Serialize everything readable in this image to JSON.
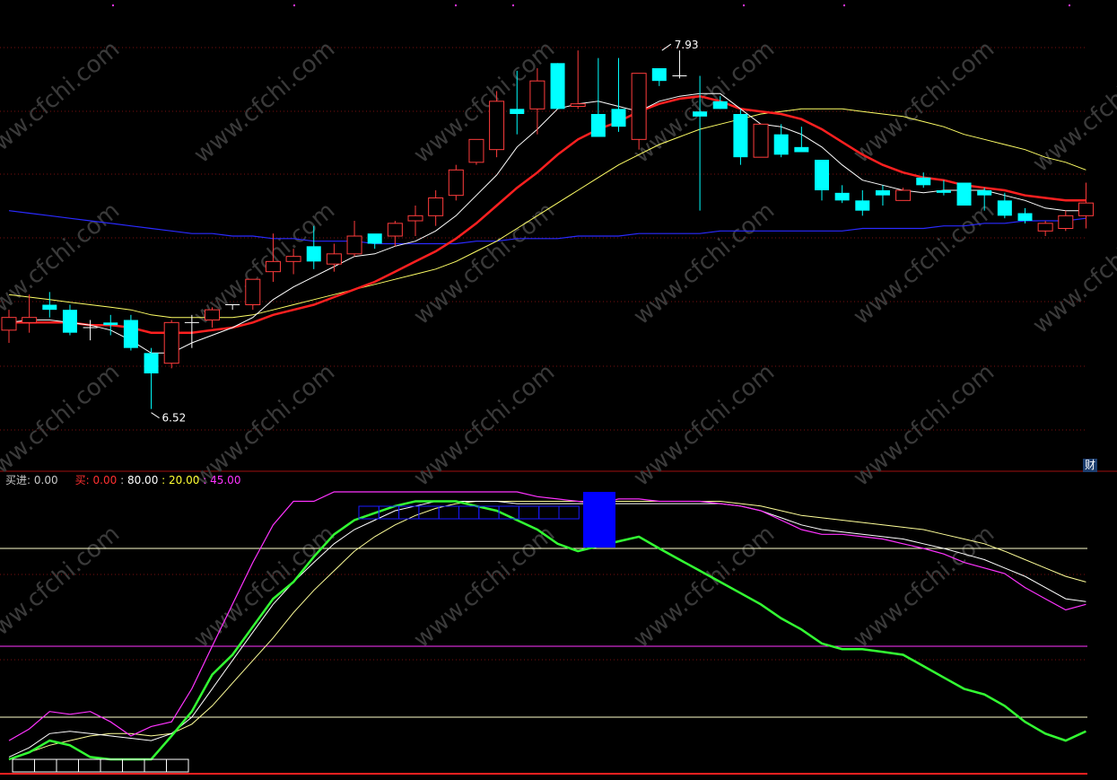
{
  "indicator": {
    "buy_in_label": "买进:",
    "buy_in_value": "0.00",
    "buy_label": "买:",
    "buy_value": "0.00",
    "sep": ":",
    "level_80": "80.00",
    "level_20": "20.00",
    "level_45": "45.00"
  },
  "fin_badge": "财",
  "watermark": "www.cfchi.com",
  "colors": {
    "background": "#000000",
    "up_candle": "#ff3c3c",
    "down_candle": "#00ffff",
    "ma_short": "#ffffff",
    "ma_mid": "#ff2020",
    "ma_long": "#ffff66",
    "ma_very_long": "#2a2aff",
    "osc_magenta": "#ff33ff",
    "osc_green": "#33ff33",
    "osc_white": "#ffffff",
    "osc_yellow": "#ffff99",
    "signal_blue": "#0000ff",
    "level_white": "#ffffcc",
    "level_magenta": "#ff33ff",
    "grid_red": "#7a1010"
  },
  "chart_data": {
    "type": "candlestick",
    "price_annotations": [
      {
        "label": "7.93",
        "kind": "high"
      },
      {
        "label": "6.52",
        "kind": "low"
      }
    ],
    "ylim": [
      6.3,
      8.1
    ],
    "candles": [
      {
        "o": 6.83,
        "h": 6.91,
        "l": 6.78,
        "c": 6.88
      },
      {
        "o": 6.86,
        "h": 6.97,
        "l": 6.82,
        "c": 6.88
      },
      {
        "o": 6.93,
        "h": 6.98,
        "l": 6.88,
        "c": 6.91
      },
      {
        "o": 6.91,
        "h": 6.93,
        "l": 6.81,
        "c": 6.82
      },
      {
        "o": 6.84,
        "h": 6.87,
        "l": 6.79,
        "c": 6.84
      },
      {
        "o": 6.86,
        "h": 6.89,
        "l": 6.81,
        "c": 6.85
      },
      {
        "o": 6.87,
        "h": 6.89,
        "l": 6.75,
        "c": 6.76
      },
      {
        "o": 6.74,
        "h": 6.76,
        "l": 6.52,
        "c": 6.66
      },
      {
        "o": 6.7,
        "h": 6.87,
        "l": 6.68,
        "c": 6.86
      },
      {
        "o": 6.86,
        "h": 6.89,
        "l": 6.76,
        "c": 6.86
      },
      {
        "o": 6.87,
        "h": 6.92,
        "l": 6.84,
        "c": 6.91
      },
      {
        "o": 6.93,
        "h": 6.93,
        "l": 6.91,
        "c": 6.93
      },
      {
        "o": 6.93,
        "h": 7.03,
        "l": 6.91,
        "c": 7.03
      },
      {
        "o": 7.06,
        "h": 7.21,
        "l": 7.02,
        "c": 7.1
      },
      {
        "o": 7.1,
        "h": 7.15,
        "l": 7.05,
        "c": 7.12
      },
      {
        "o": 7.16,
        "h": 7.24,
        "l": 7.07,
        "c": 7.1
      },
      {
        "o": 7.09,
        "h": 7.17,
        "l": 7.06,
        "c": 7.13
      },
      {
        "o": 7.13,
        "h": 7.26,
        "l": 7.12,
        "c": 7.2
      },
      {
        "o": 7.21,
        "h": 7.2,
        "l": 7.15,
        "c": 7.17
      },
      {
        "o": 7.2,
        "h": 7.26,
        "l": 7.16,
        "c": 7.25
      },
      {
        "o": 7.26,
        "h": 7.32,
        "l": 7.2,
        "c": 7.28
      },
      {
        "o": 7.28,
        "h": 7.38,
        "l": 7.24,
        "c": 7.35
      },
      {
        "o": 7.36,
        "h": 7.48,
        "l": 7.34,
        "c": 7.46
      },
      {
        "o": 7.49,
        "h": 7.58,
        "l": 7.48,
        "c": 7.58
      },
      {
        "o": 7.54,
        "h": 7.77,
        "l": 7.51,
        "c": 7.73
      },
      {
        "o": 7.7,
        "h": 7.85,
        "l": 7.6,
        "c": 7.68
      },
      {
        "o": 7.7,
        "h": 7.86,
        "l": 7.6,
        "c": 7.81
      },
      {
        "o": 7.88,
        "h": 7.88,
        "l": 7.71,
        "c": 7.7
      },
      {
        "o": 7.71,
        "h": 7.93,
        "l": 7.7,
        "c": 7.72
      },
      {
        "o": 7.68,
        "h": 7.9,
        "l": 7.59,
        "c": 7.59
      },
      {
        "o": 7.7,
        "h": 7.9,
        "l": 7.61,
        "c": 7.63
      },
      {
        "o": 7.58,
        "h": 7.84,
        "l": 7.54,
        "c": 7.84
      },
      {
        "o": 7.86,
        "h": 7.86,
        "l": 7.79,
        "c": 7.81
      },
      {
        "o": 7.83,
        "h": 7.93,
        "l": 7.82,
        "c": 7.83
      },
      {
        "o": 7.69,
        "h": 7.83,
        "l": 7.3,
        "c": 7.67
      },
      {
        "o": 7.73,
        "h": 7.75,
        "l": 7.7,
        "c": 7.7
      },
      {
        "o": 7.68,
        "h": 7.7,
        "l": 7.48,
        "c": 7.51
      },
      {
        "o": 7.51,
        "h": 7.64,
        "l": 7.51,
        "c": 7.64
      },
      {
        "o": 7.6,
        "h": 7.64,
        "l": 7.51,
        "c": 7.52
      },
      {
        "o": 7.55,
        "h": 7.63,
        "l": 7.53,
        "c": 7.53
      },
      {
        "o": 7.5,
        "h": 7.5,
        "l": 7.34,
        "c": 7.38
      },
      {
        "o": 7.37,
        "h": 7.4,
        "l": 7.33,
        "c": 7.34
      },
      {
        "o": 7.34,
        "h": 7.38,
        "l": 7.28,
        "c": 7.3
      },
      {
        "o": 7.38,
        "h": 7.4,
        "l": 7.32,
        "c": 7.36
      },
      {
        "o": 7.34,
        "h": 7.39,
        "l": 7.34,
        "c": 7.38
      },
      {
        "o": 7.43,
        "h": 7.45,
        "l": 7.39,
        "c": 7.4
      },
      {
        "o": 7.38,
        "h": 7.42,
        "l": 7.36,
        "c": 7.37
      },
      {
        "o": 7.41,
        "h": 7.41,
        "l": 7.33,
        "c": 7.32
      },
      {
        "o": 7.38,
        "h": 7.39,
        "l": 7.3,
        "c": 7.36
      },
      {
        "o": 7.34,
        "h": 7.37,
        "l": 7.27,
        "c": 7.28
      },
      {
        "o": 7.29,
        "h": 7.31,
        "l": 7.25,
        "c": 7.26
      },
      {
        "o": 7.22,
        "h": 7.26,
        "l": 7.2,
        "c": 7.25
      },
      {
        "o": 7.23,
        "h": 7.3,
        "l": 7.22,
        "c": 7.28
      },
      {
        "o": 7.28,
        "h": 7.41,
        "l": 7.23,
        "c": 7.33
      }
    ],
    "ma_short": [
      6.86,
      6.87,
      6.87,
      6.86,
      6.85,
      6.83,
      6.79,
      6.74,
      6.74,
      6.78,
      6.81,
      6.84,
      6.88,
      6.95,
      7.0,
      7.04,
      7.08,
      7.12,
      7.13,
      7.16,
      7.18,
      7.22,
      7.28,
      7.36,
      7.44,
      7.55,
      7.62,
      7.7,
      7.72,
      7.73,
      7.71,
      7.69,
      7.73,
      7.75,
      7.76,
      7.76,
      7.7,
      7.64,
      7.63,
      7.6,
      7.55,
      7.48,
      7.42,
      7.4,
      7.38,
      7.37,
      7.38,
      7.38,
      7.38,
      7.36,
      7.34,
      7.31,
      7.3,
      7.3
    ],
    "ma_mid": [
      6.86,
      6.86,
      6.86,
      6.86,
      6.85,
      6.85,
      6.84,
      6.82,
      6.82,
      6.82,
      6.83,
      6.84,
      6.86,
      6.89,
      6.91,
      6.93,
      6.96,
      6.99,
      7.02,
      7.06,
      7.1,
      7.14,
      7.19,
      7.25,
      7.32,
      7.39,
      7.45,
      7.52,
      7.58,
      7.62,
      7.65,
      7.69,
      7.72,
      7.74,
      7.75,
      7.73,
      7.7,
      7.69,
      7.68,
      7.66,
      7.62,
      7.57,
      7.52,
      7.48,
      7.45,
      7.43,
      7.42,
      7.4,
      7.39,
      7.38,
      7.36,
      7.35,
      7.34,
      7.34
    ],
    "ma_long": [
      6.97,
      6.96,
      6.95,
      6.94,
      6.93,
      6.92,
      6.91,
      6.89,
      6.88,
      6.88,
      6.88,
      6.88,
      6.89,
      6.91,
      6.93,
      6.95,
      6.97,
      6.99,
      7.01,
      7.03,
      7.05,
      7.07,
      7.1,
      7.14,
      7.18,
      7.23,
      7.28,
      7.33,
      7.38,
      7.43,
      7.48,
      7.52,
      7.56,
      7.59,
      7.62,
      7.64,
      7.66,
      7.68,
      7.69,
      7.7,
      7.7,
      7.7,
      7.69,
      7.68,
      7.67,
      7.65,
      7.63,
      7.6,
      7.58,
      7.56,
      7.54,
      7.51,
      7.49,
      7.46
    ],
    "ma_very_long": [
      7.3,
      7.29,
      7.28,
      7.27,
      7.26,
      7.25,
      7.24,
      7.23,
      7.22,
      7.21,
      7.21,
      7.2,
      7.2,
      7.19,
      7.19,
      7.18,
      7.18,
      7.18,
      7.17,
      7.17,
      7.17,
      7.17,
      7.17,
      7.18,
      7.18,
      7.19,
      7.19,
      7.19,
      7.2,
      7.2,
      7.2,
      7.21,
      7.21,
      7.21,
      7.21,
      7.22,
      7.22,
      7.22,
      7.22,
      7.22,
      7.22,
      7.22,
      7.23,
      7.23,
      7.23,
      7.23,
      7.24,
      7.24,
      7.25,
      7.25,
      7.26,
      7.26,
      7.26,
      7.27
    ],
    "oscillator": {
      "ylim": [
        -5,
        110
      ],
      "levels": [
        80,
        20,
        45
      ],
      "magenta": [
        10,
        15,
        22,
        21,
        22,
        18,
        12,
        16,
        18,
        30,
        45,
        60,
        75,
        90,
        100,
        100,
        104,
        104,
        104,
        104,
        104,
        104,
        104,
        104,
        104,
        104,
        102,
        101,
        100,
        99,
        101,
        101,
        100,
        100,
        100,
        99,
        98,
        96,
        92,
        88,
        86,
        86,
        85,
        84,
        82,
        80,
        78,
        75,
        73,
        71,
        66,
        62,
        58,
        60
      ],
      "green": [
        2,
        5,
        10,
        8,
        3,
        2,
        2,
        2,
        12,
        22,
        35,
        42,
        52,
        62,
        68,
        77,
        86,
        92,
        95,
        98,
        100,
        100,
        100,
        98,
        96,
        92,
        88,
        82,
        79,
        81,
        83,
        85,
        80,
        76,
        72,
        68,
        64,
        60,
        55,
        51,
        46,
        44,
        44,
        43,
        42,
        38,
        34,
        30,
        28,
        24,
        18,
        13,
        10,
        14
      ],
      "white": [
        3,
        7,
        13,
        14,
        13,
        12,
        11,
        10,
        13,
        20,
        30,
        40,
        50,
        60,
        68,
        75,
        82,
        88,
        92,
        96,
        98,
        100,
        100,
        100,
        100,
        99,
        99,
        99,
        99,
        99,
        99,
        99,
        99,
        99,
        99,
        99,
        98,
        96,
        93,
        90,
        88,
        87,
        86,
        85,
        84,
        82,
        80,
        78,
        76,
        73,
        70,
        66,
        62,
        61
      ],
      "yellow": [
        2,
        5,
        8,
        10,
        12,
        13,
        13,
        12,
        13,
        17,
        24,
        32,
        40,
        48,
        57,
        65,
        72,
        79,
        85,
        90,
        94,
        97,
        99,
        100,
        100,
        100,
        100,
        100,
        100,
        100,
        100,
        100,
        100,
        100,
        100,
        100,
        99,
        98,
        96,
        94,
        93,
        92,
        91,
        90,
        89,
        88,
        86,
        84,
        82,
        79,
        76,
        73,
        70,
        68
      ]
    }
  }
}
